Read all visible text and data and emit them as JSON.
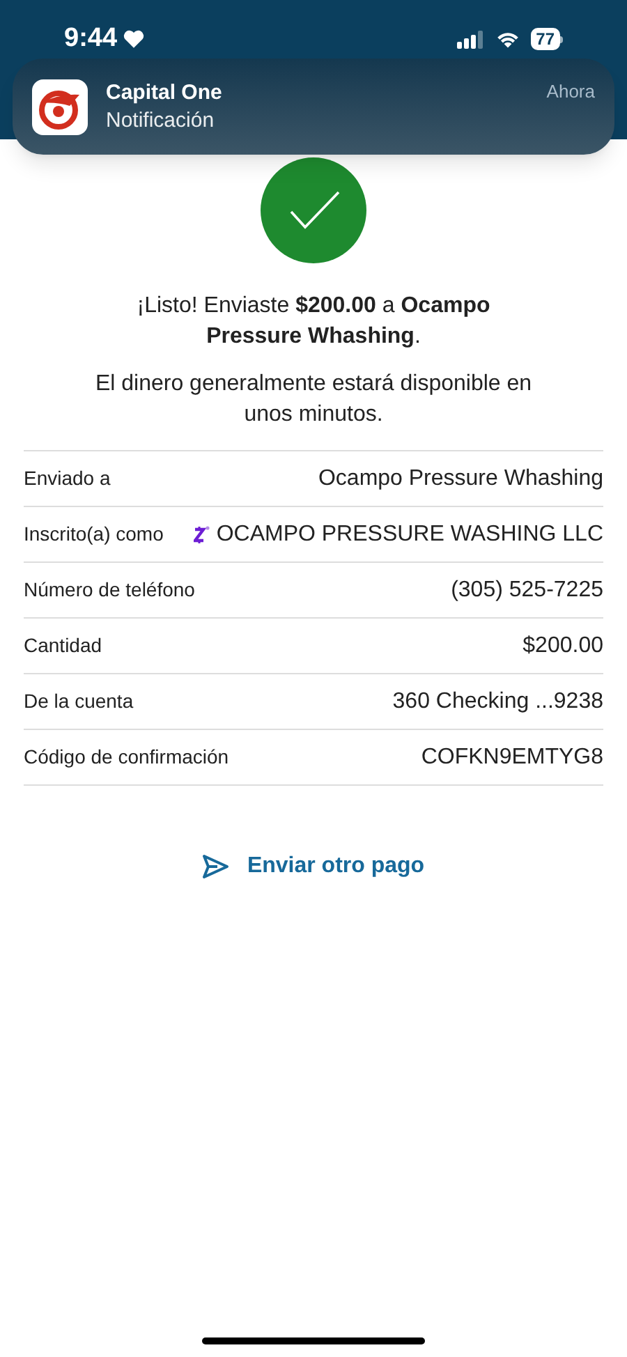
{
  "status_bar": {
    "time": "9:44",
    "battery": "77"
  },
  "notification": {
    "app": "Capital One",
    "message": "Notificación",
    "time": "Ahora"
  },
  "confirmation": {
    "headline": "¡Listo! Enviaste **$200.00** a **Ocampo Pressure Whashing**.",
    "subtext": "El dinero generalmente estará disponible en unos minutos."
  },
  "details": [
    {
      "kind": "text",
      "label": "Enviado a",
      "value": "Ocampo Pressure Whashing"
    },
    {
      "kind": "zelle",
      "label": "Inscrito(a) como",
      "value": "OCAMPO PRESSURE WASHING LLC"
    },
    {
      "kind": "text",
      "label": "Número de teléfono",
      "value": "(305) 525-7225"
    },
    {
      "kind": "text",
      "label": "Cantidad",
      "value": "$200.00"
    },
    {
      "kind": "text",
      "label": "De la cuenta",
      "value": "360 Checking ...9238"
    },
    {
      "kind": "text",
      "label": "Código de confirmación",
      "value": "COFKN9EMTYG8"
    }
  ],
  "action": {
    "label": "Enviar otro pago"
  }
}
